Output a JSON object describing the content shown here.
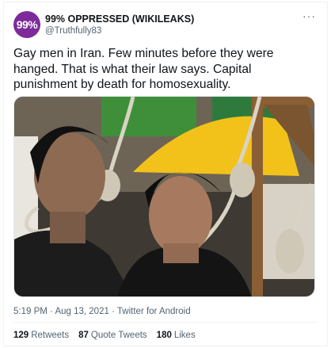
{
  "author": {
    "avatar_text": "99%",
    "display_name": "99% OPPRESSED (WIKILEAKS)",
    "handle": "@Truthfully83"
  },
  "more_icon": "more-horizontal-icon",
  "tweet": {
    "line1": "Gay men in Iran. Few minutes before they were",
    "line2": "hanged. That is what their law says. Capital",
    "line3": "punishment by death for  homosexuality."
  },
  "meta": {
    "time": "5:19 PM",
    "date": "Aug 13, 2021",
    "source": "Twitter for Android",
    "separator": "·"
  },
  "stats": {
    "retweets_count": "129",
    "retweets_label": "Retweets",
    "quotes_count": "87",
    "quotes_label": "Quote Tweets",
    "likes_count": "180",
    "likes_label": "Likes"
  },
  "colors": {
    "avatar_bg": "#7d2b9a",
    "secondary_text": "#536471",
    "divider": "#eff3f4"
  }
}
